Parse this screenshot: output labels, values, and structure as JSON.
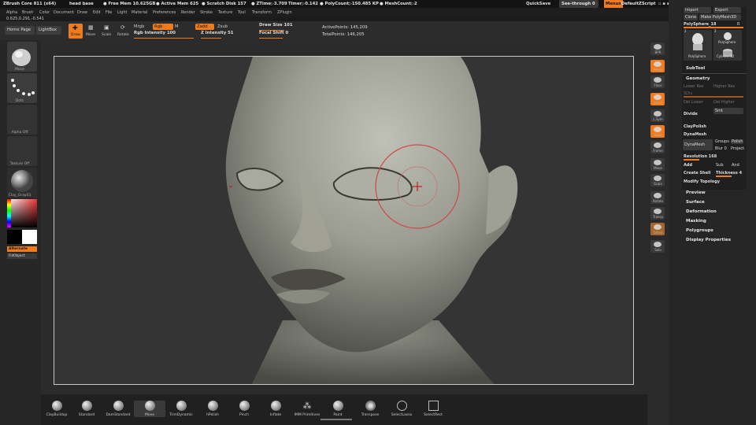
{
  "titlebar": {
    "app": "ZBrush Core 811 (x64)",
    "doc": "head base",
    "free_mem": "● Free Mem 10.625GB",
    "active_mem": "● Active Mem 625",
    "scratch": "● Scratch Disk 157",
    "ztime": "● ZTime▷3.709",
    "timer": "Timer▷0.142",
    "polycount": "● PolyCount▷150.485 KP",
    "meshcount": "● MeshCount▷2",
    "quicksave": "QuickSave",
    "seethrough": "See-through",
    "seethrough_value": "0",
    "menus": "Menus",
    "default_script": "DefaultZScript"
  },
  "menubar": [
    "Alpha",
    "Brush",
    "Color",
    "Document",
    "Draw",
    "Edit",
    "File",
    "Light",
    "Material",
    "Preferences",
    "Render",
    "Stroke",
    "Texture",
    "Tool",
    "Transform",
    "ZPlugin"
  ],
  "coords": "0.625,0.291,-0.541",
  "topbar": {
    "home_page": "Home Page",
    "lightbox": "LightBox",
    "draw": "Draw",
    "move": "Move",
    "scale": "Scale",
    "rotate": "Rotate",
    "mrgb": "Mrgb",
    "rgb": "Rgb",
    "m": "M",
    "rgb_intensity": "Rgb Intensity 100",
    "zadd": "Zadd",
    "zsub": "Zsub",
    "z_intensity": "Z Intensity 51",
    "draw_size": "Draw Size 101",
    "focal_shift": "Focal Shift 0",
    "active_points": "ActivePoints: 145,209",
    "total_points": "TotalPoints: 146,205"
  },
  "left_shelf": {
    "items": [
      "Move",
      "Dots",
      "Alpha Off",
      "Texture Off",
      "Clay_Gray03"
    ],
    "alternate": "Alternate",
    "fill_object": "FillObject"
  },
  "bottom_shelf": [
    "ClayBuildup",
    "Standard",
    "DamStandard",
    "Move",
    "TrimDynamic",
    "hPolish",
    "Pinch",
    "Inflate",
    "IMM Primitives",
    "Paint",
    "Transpose",
    "SelectLasso",
    "SelectRect"
  ],
  "right_shelf": [
    "BPR",
    "Persp",
    "Floor",
    "Local",
    "L.Sym",
    "Gxyz",
    "Frame",
    "Move",
    "Scale",
    "Rotate",
    "Transp",
    "Ghost",
    "Solo"
  ],
  "tool_panel": {
    "import": "Import",
    "export": "Export",
    "clone": "Clone",
    "make_polymesh": "Make PolyMesh3D",
    "polysphere_slider": "PolySphere_18",
    "r": "R",
    "thumb1_count": "2",
    "thumb2_count": "2",
    "thumb1": "PolySphere",
    "thumb2": "PolySphere",
    "thumb3": "Cylinder3D",
    "subtool": "SubTool",
    "geometry": "Geometry",
    "lower_res": "Lower Res",
    "higher_res": "Higher Res",
    "sdiv": "SDiv",
    "del_lower": "Del Lower",
    "del_higher": "Del Higher",
    "divide": "Divide",
    "smt": "Smt",
    "claypolish": "ClayPolish",
    "dynamesh_label": "DynaMesh",
    "dynamesh_btn": "DynaMesh",
    "groups": "Groups",
    "polish": "Polish",
    "blur": "Blur 0",
    "project": "Project",
    "resolution": "Resolution 168",
    "add": "Add",
    "sub": "Sub",
    "and": "And",
    "create_shell": "Create Shell",
    "thickness": "Thickness 4",
    "modify_topology": "Modify Topology",
    "sections": [
      "Preview",
      "Surface",
      "Deformation",
      "Masking",
      "Polygroups",
      "Display Properties"
    ]
  },
  "colors": {
    "accent": "#ee7b1e",
    "viewport": "#343434",
    "skin": "#8e8f84"
  }
}
